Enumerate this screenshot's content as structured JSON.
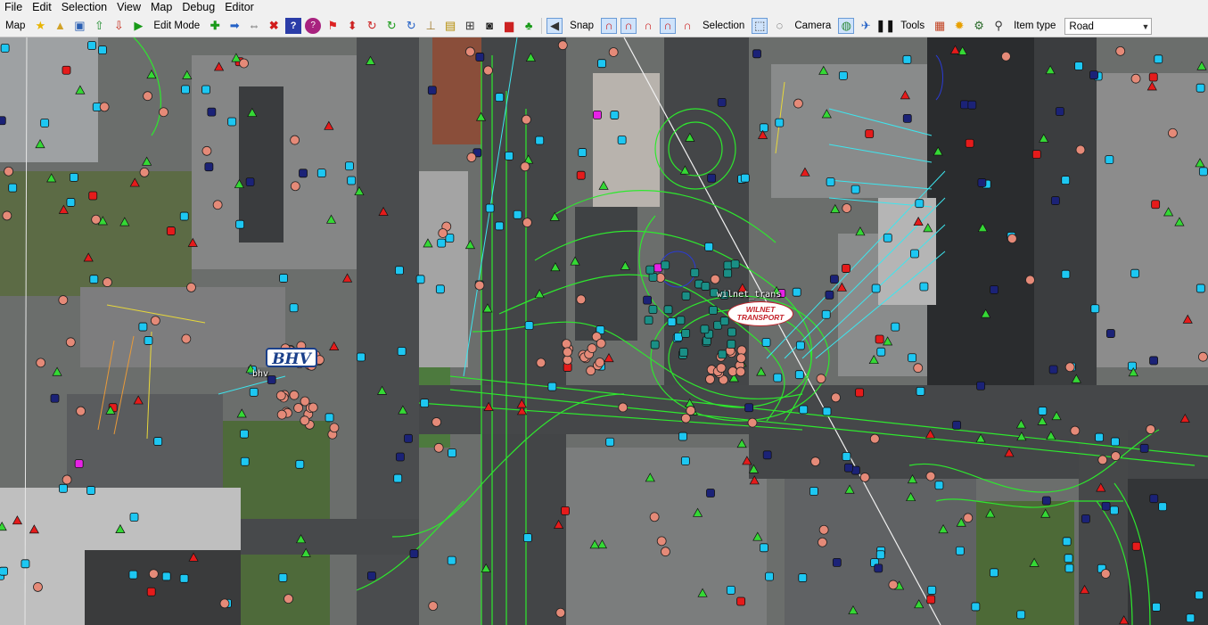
{
  "menu": {
    "items": [
      "File",
      "Edit",
      "Selection",
      "View",
      "Map",
      "Debug",
      "Editor"
    ]
  },
  "toolbar": {
    "map_label": "Map",
    "edit_mode_label": "Edit Mode",
    "snap_label": "Snap",
    "selection_label": "Selection",
    "camera_label": "Camera",
    "tools_label": "Tools",
    "item_type_label": "Item type",
    "item_type_value": "Road"
  },
  "map": {
    "companies": [
      {
        "logo_text": "BHV",
        "label": "bhv"
      },
      {
        "logo_text": [
          "WILNET",
          "TRANSPORT"
        ],
        "label": "wilnet_trans"
      }
    ]
  },
  "colors": {
    "road_line": "#2ee82e",
    "lane_cyan": "#3de6ef",
    "prefab_node": "#1dc7f2",
    "navy_node": "#1b2277",
    "red_node": "#e51b1b",
    "green_marker": "#35d835",
    "sign_marker": "#e58a78",
    "magenta_node": "#e622e6"
  }
}
